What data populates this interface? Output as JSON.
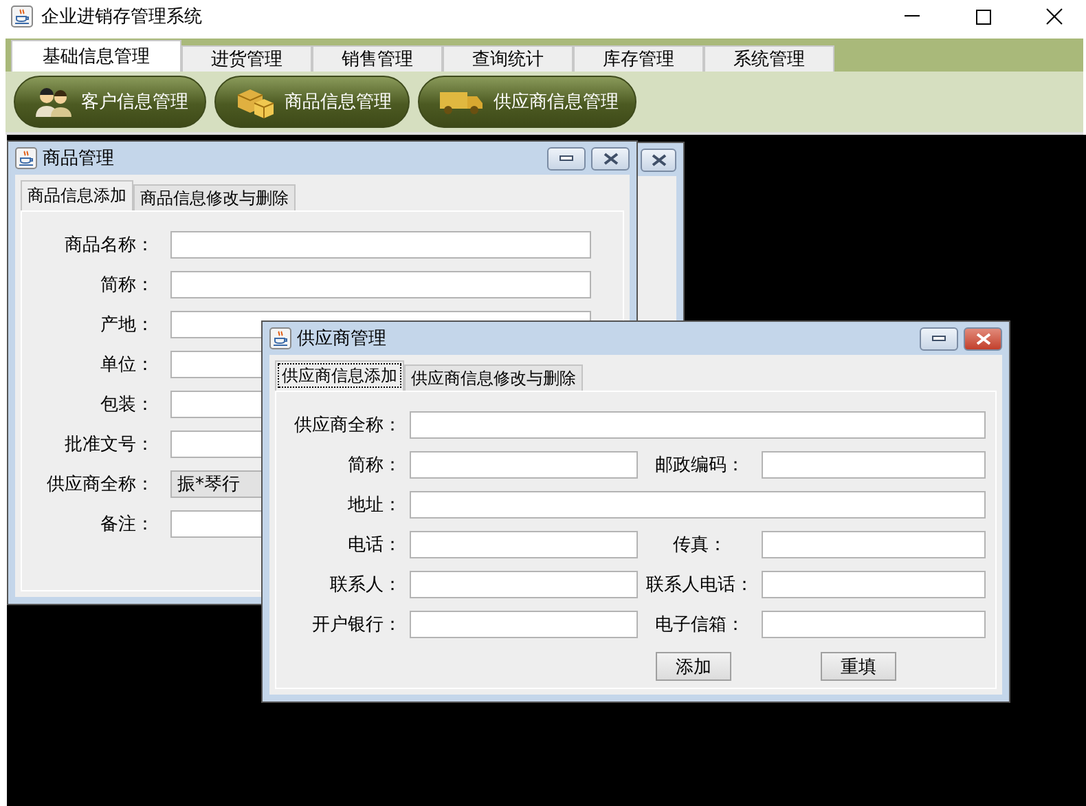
{
  "window": {
    "title": "企业进销存管理系统"
  },
  "menu_tabs": [
    {
      "label": "基础信息管理",
      "selected": true
    },
    {
      "label": "进货管理",
      "selected": false
    },
    {
      "label": "销售管理",
      "selected": false
    },
    {
      "label": "查询统计",
      "selected": false
    },
    {
      "label": "库存管理",
      "selected": false
    },
    {
      "label": "系统管理",
      "selected": false
    }
  ],
  "toolbar_buttons": [
    {
      "label": "客户信息管理",
      "kind": "customer"
    },
    {
      "label": "商品信息管理",
      "kind": "product"
    },
    {
      "label": "供应商信息管理",
      "kind": "supplier"
    }
  ],
  "product_window": {
    "title": "商品管理",
    "tabs": [
      {
        "label": "商品信息添加",
        "selected": true
      },
      {
        "label": "商品信息修改与删除",
        "selected": false
      }
    ],
    "fields": [
      {
        "label": "商品名称：",
        "kind": "text"
      },
      {
        "label": "简称：",
        "kind": "text"
      },
      {
        "label": "产地：",
        "kind": "text"
      },
      {
        "label": "单位：",
        "kind": "text"
      },
      {
        "label": "包装：",
        "kind": "text"
      },
      {
        "label": "批准文号：",
        "kind": "text"
      },
      {
        "label": "供应商全称：",
        "kind": "combo",
        "value": "振*琴行"
      },
      {
        "label": "备注：",
        "kind": "text"
      }
    ]
  },
  "supplier_window": {
    "title": "供应商管理",
    "tabs": [
      {
        "label": "供应商信息添加",
        "selected": true
      },
      {
        "label": "供应商信息修改与删除",
        "selected": false
      }
    ],
    "rows": [
      [
        {
          "label": "供应商全称："
        }
      ],
      [
        {
          "label": "简称："
        },
        {
          "label": "邮政编码："
        }
      ],
      [
        {
          "label": "地址："
        }
      ],
      [
        {
          "label": "电话："
        },
        {
          "label": "传真："
        }
      ],
      [
        {
          "label": "联系人："
        },
        {
          "label": "联系人电话："
        }
      ],
      [
        {
          "label": "开户银行："
        },
        {
          "label": "电子信箱："
        }
      ]
    ],
    "buttons": [
      "添加",
      "重填"
    ]
  }
}
